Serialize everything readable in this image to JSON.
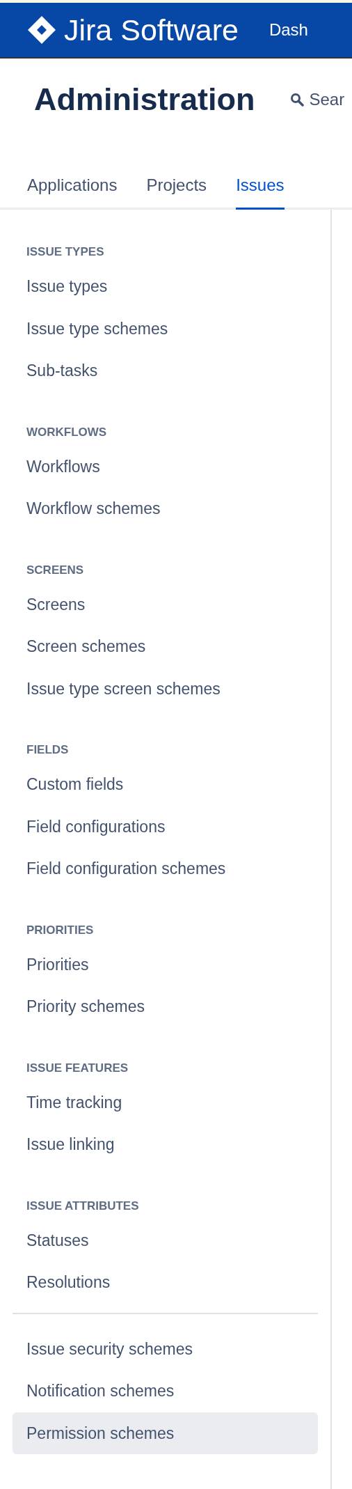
{
  "header": {
    "product": "Jira Software",
    "nav_item": "Dash"
  },
  "page": {
    "title": "Administration",
    "search": "Sear"
  },
  "tabs": [
    {
      "label": "Applications",
      "selected": false
    },
    {
      "label": "Projects",
      "selected": false
    },
    {
      "label": "Issues",
      "selected": true
    }
  ],
  "sidebar": {
    "sections": [
      {
        "heading": "ISSUE TYPES",
        "items": [
          {
            "label": "Issue types",
            "selected": false
          },
          {
            "label": "Issue type schemes",
            "selected": false
          },
          {
            "label": "Sub-tasks",
            "selected": false
          }
        ]
      },
      {
        "heading": "WORKFLOWS",
        "items": [
          {
            "label": "Workflows",
            "selected": false
          },
          {
            "label": "Workflow schemes",
            "selected": false
          }
        ]
      },
      {
        "heading": "SCREENS",
        "items": [
          {
            "label": "Screens",
            "selected": false
          },
          {
            "label": "Screen schemes",
            "selected": false
          },
          {
            "label": "Issue type screen schemes",
            "selected": false
          }
        ]
      },
      {
        "heading": "FIELDS",
        "items": [
          {
            "label": "Custom fields",
            "selected": false
          },
          {
            "label": "Field configurations",
            "selected": false
          },
          {
            "label": "Field configuration schemes",
            "selected": false
          }
        ]
      },
      {
        "heading": "PRIORITIES",
        "items": [
          {
            "label": "Priorities",
            "selected": false
          },
          {
            "label": "Priority schemes",
            "selected": false
          }
        ]
      },
      {
        "heading": "ISSUE FEATURES",
        "items": [
          {
            "label": "Time tracking",
            "selected": false
          },
          {
            "label": "Issue linking",
            "selected": false
          }
        ]
      },
      {
        "heading": "ISSUE ATTRIBUTES",
        "items": [
          {
            "label": "Statuses",
            "selected": false
          },
          {
            "label": "Resolutions",
            "selected": false
          }
        ]
      }
    ],
    "extra_items": [
      {
        "label": "Issue security schemes",
        "selected": false
      },
      {
        "label": "Notification schemes",
        "selected": false
      },
      {
        "label": "Permission schemes",
        "selected": true
      }
    ]
  }
}
